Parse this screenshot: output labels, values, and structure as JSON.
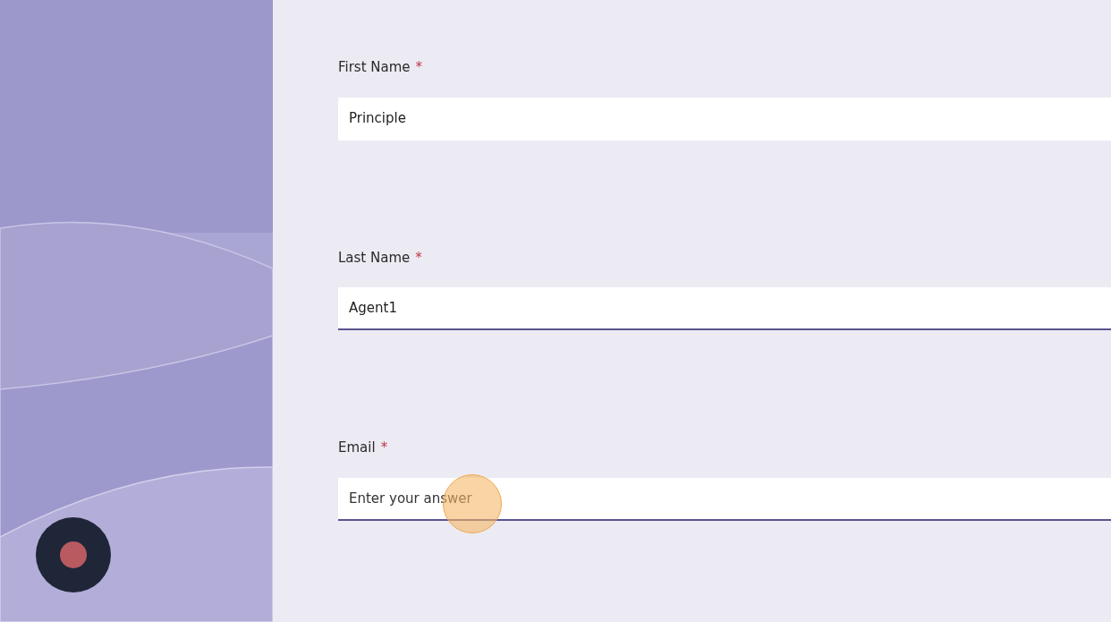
{
  "fields": [
    {
      "label": "First Name",
      "required_mark": "*",
      "value": "Principle",
      "underlined": false
    },
    {
      "label": "Last Name",
      "required_mark": "*",
      "value": "Agent1",
      "underlined": true
    },
    {
      "label": "Email",
      "required_mark": "*",
      "placeholder": "Enter your answer",
      "underlined": true
    }
  ]
}
